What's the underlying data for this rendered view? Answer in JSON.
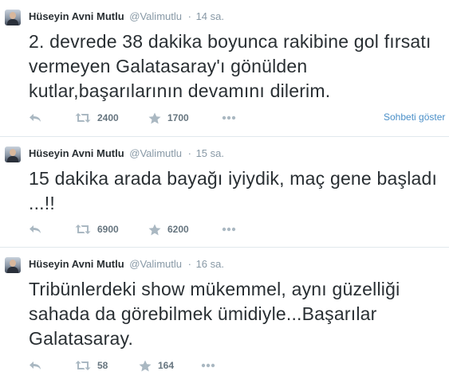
{
  "colors": {
    "name": "#292f33",
    "meta": "#8899a6",
    "link": "#4a8fc8",
    "divider": "#e1e8ed"
  },
  "icons": {
    "reply": "reply-arrow-icon",
    "retweet": "retweet-icon",
    "favorite": "star-icon",
    "more": "ellipsis-icon"
  },
  "tweets": [
    {
      "fullname": "Hüseyin Avni Mutlu",
      "username": "@Valimutlu",
      "dot": "·",
      "time": "14 sa.",
      "text": "2. devrede 38 dakika boyunca rakibine gol fırsatı vermeyen Galatasaray'ı gönülden kutlar,başarılarının devamını dilerim.",
      "retweets": "2400",
      "favorites": "1700",
      "conversation_link": "Sohbeti göster"
    },
    {
      "fullname": "Hüseyin Avni Mutlu",
      "username": "@Valimutlu",
      "dot": "·",
      "time": "15 sa.",
      "text": "15 dakika arada bayağı iyiydik, maç gene başladı ...!!",
      "retweets": "6900",
      "favorites": "6200"
    },
    {
      "fullname": "Hüseyin Avni Mutlu",
      "username": "@Valimutlu",
      "dot": "·",
      "time": "16 sa.",
      "text": "Tribünlerdeki show mükemmel, aynı güzelliği sahada da görebilmek ümidiyle...Başarılar Galatasaray.",
      "retweets": "58",
      "favorites": "164"
    }
  ]
}
